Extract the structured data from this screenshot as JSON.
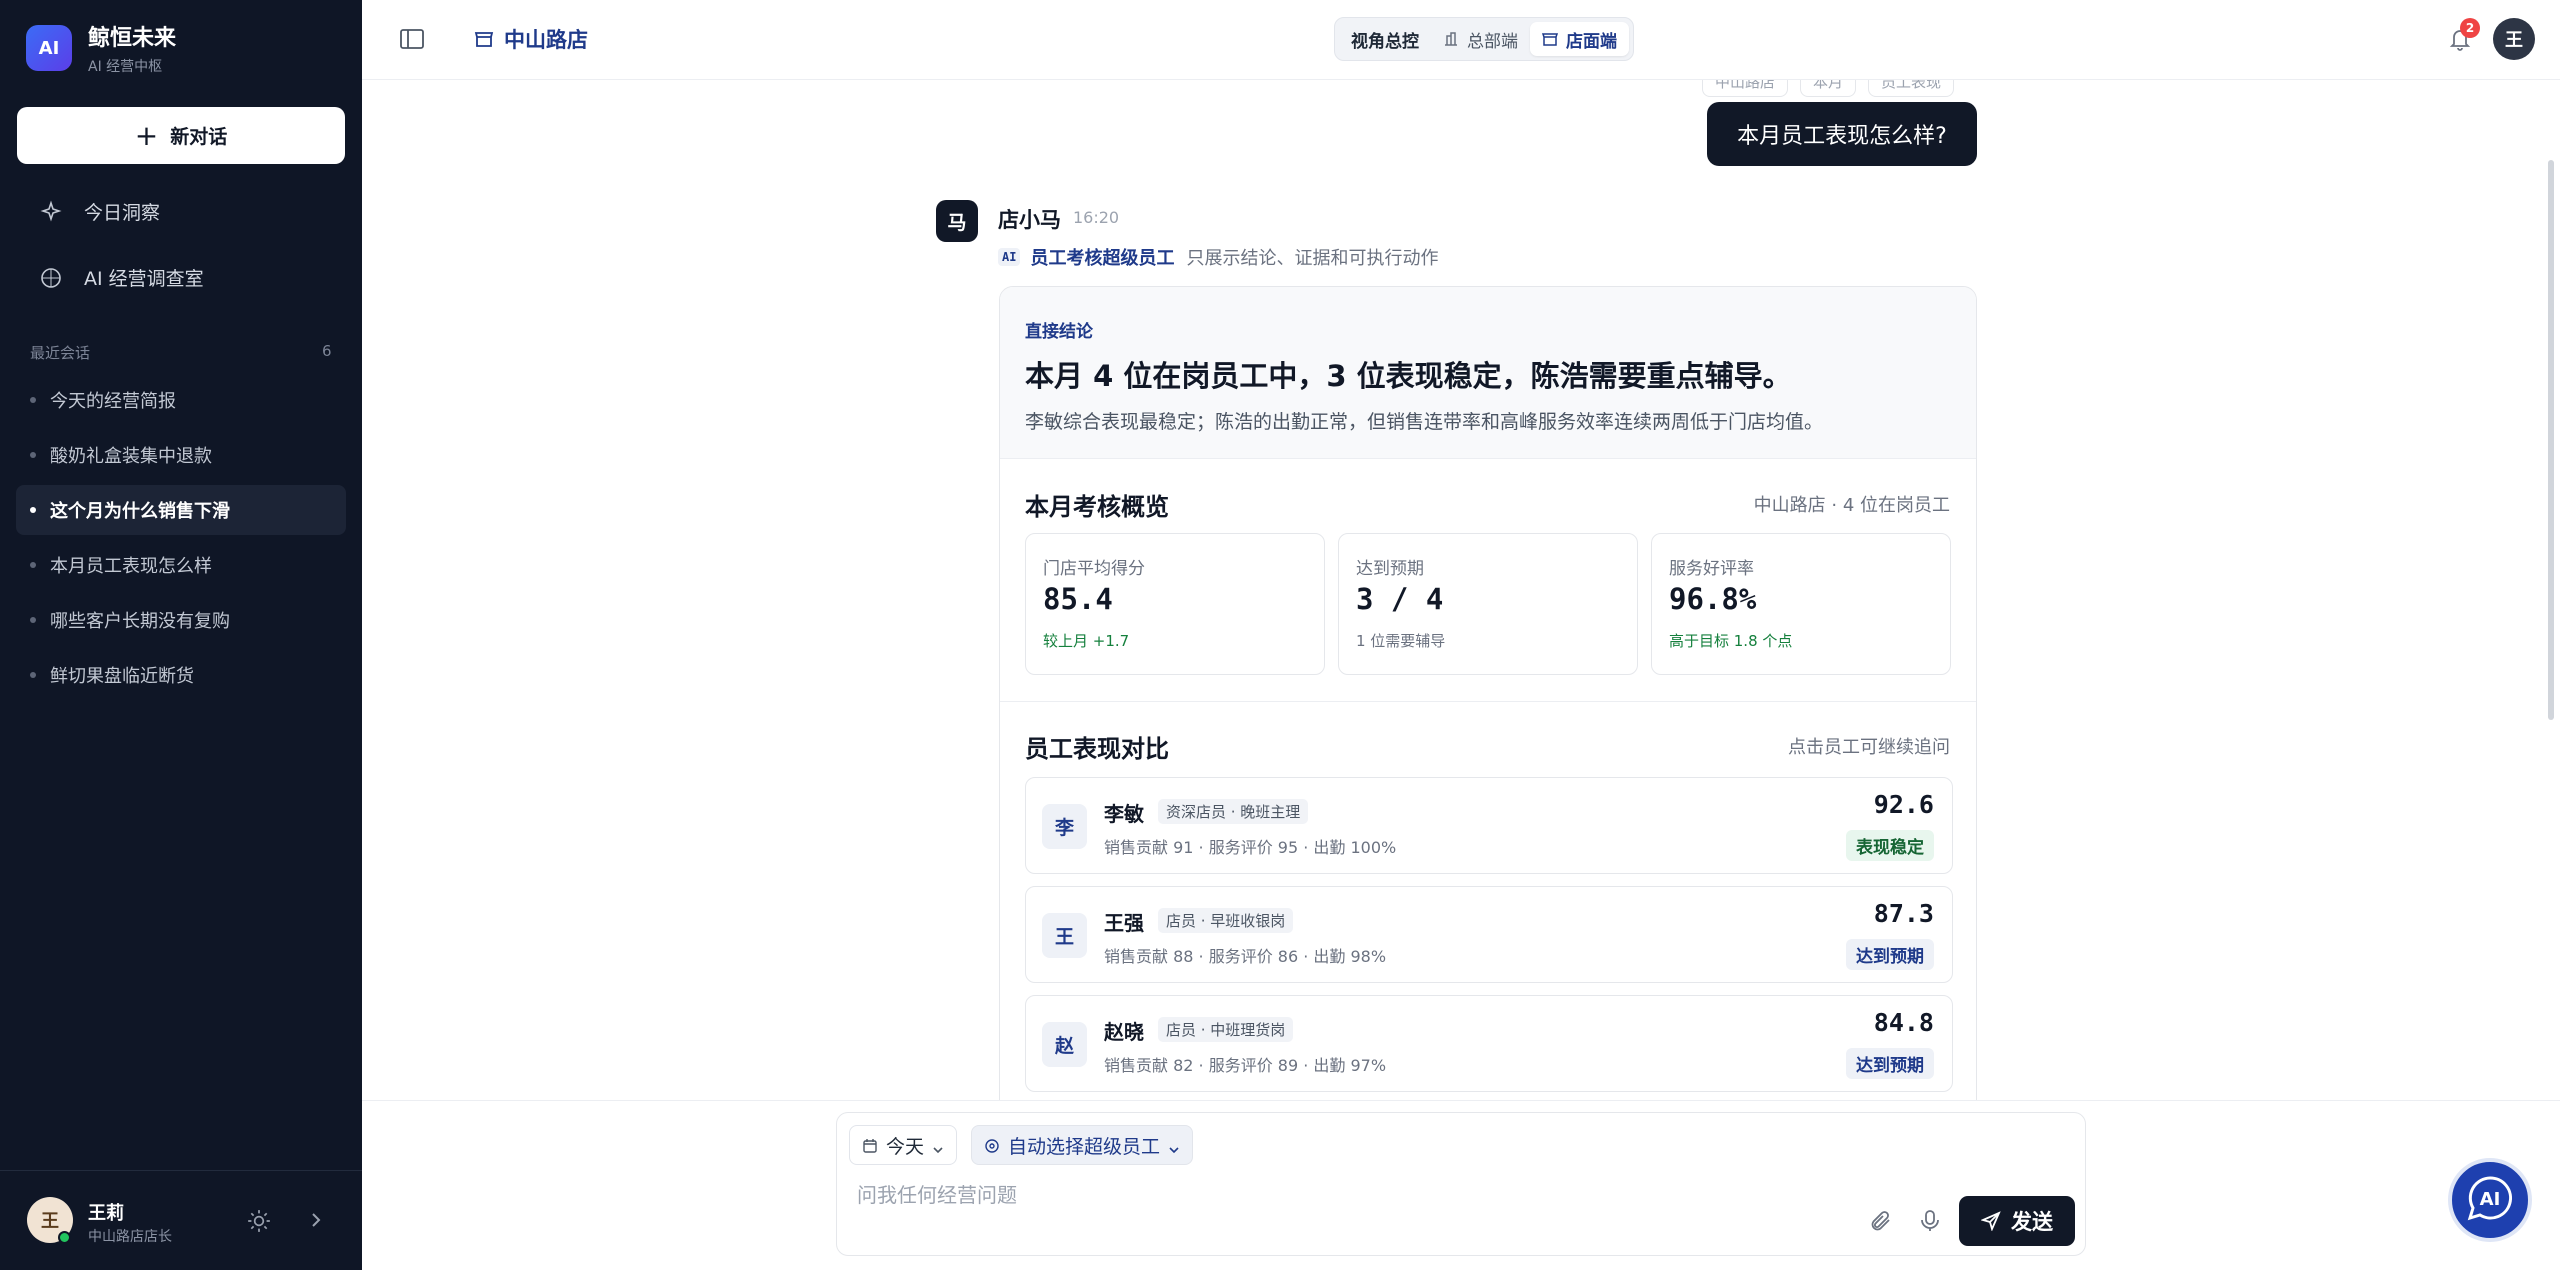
{
  "brand": {
    "logo": "AI",
    "name": "鲸恒未来",
    "subtitle": "AI 经营中枢"
  },
  "sidebar": {
    "new_chat": "新对话",
    "nav": [
      {
        "label": "今日洞察",
        "icon": "sparkle-icon"
      },
      {
        "label": "AI 经营调查室",
        "icon": "compass-icon"
      }
    ],
    "recent_label": "最近会话",
    "recent_count": "6",
    "conversations": [
      {
        "label": "今天的经营简报",
        "active": false
      },
      {
        "label": "酸奶礼盒装集中退款",
        "active": false
      },
      {
        "label": "这个月为什么销售下滑",
        "active": true
      },
      {
        "label": "本月员工表现怎么样",
        "active": false
      },
      {
        "label": "哪些客户长期没有复购",
        "active": false
      },
      {
        "label": "鲜切果盘临近断货",
        "active": false
      }
    ],
    "user": {
      "avatar": "王",
      "name": "王莉",
      "role": "中山路店店长"
    }
  },
  "header": {
    "store": "中山路店",
    "view_label": "视角总控",
    "view_options": [
      {
        "label": "总部端",
        "icon": "building-icon",
        "selected": false
      },
      {
        "label": "店面端",
        "icon": "store-icon",
        "selected": true
      }
    ],
    "notifications": "2",
    "avatar": "王"
  },
  "chat": {
    "prev_chips": [
      "中山路店",
      "本月",
      "员工表现"
    ],
    "user_message": "本月员工表现怎么样?",
    "bot": {
      "avatar": "马",
      "name": "店小马",
      "time": "16:20",
      "agent_tag": "AI",
      "agent_name": "员工考核超级员工",
      "agent_note": "只展示结论、证据和可执行动作"
    },
    "card": {
      "conclusion_label": "直接结论",
      "conclusion_title": "本月 4 位在岗员工中，3 位表现稳定，陈浩需要重点辅导。",
      "conclusion_desc": "李敏综合表现最稳定；陈浩的出勤正常，但销售连带率和高峰服务效率连续两周低于门店均值。",
      "overview_title": "本月考核概览",
      "overview_sub": "中山路店 · 4 位在岗员工",
      "stats": [
        {
          "label": "门店平均得分",
          "value": "85.4",
          "note": "较上月 +1.7",
          "tone": "green"
        },
        {
          "label": "达到预期",
          "value": "3 / 4",
          "note": "1 位需要辅导",
          "tone": "gray"
        },
        {
          "label": "服务好评率",
          "value": "96.8%",
          "note": "高于目标 1.8 个点",
          "tone": "green"
        }
      ],
      "compare_title": "员工表现对比",
      "compare_sub": "点击员工可继续追问",
      "employees": [
        {
          "avatar": "李",
          "name": "李敏",
          "role": "资深店员 · 晚班主理",
          "metrics": "销售贡献 91 · 服务评价 95 · 出勤 100%",
          "score": "92.6",
          "badge": "表现稳定",
          "tone": "green"
        },
        {
          "avatar": "王",
          "name": "王强",
          "role": "店员 · 早班收银岗",
          "metrics": "销售贡献 88 · 服务评价 86 · 出勤 98%",
          "score": "87.3",
          "badge": "达到预期",
          "tone": "blue"
        },
        {
          "avatar": "赵",
          "name": "赵晓",
          "role": "店员 · 中班理货岗",
          "metrics": "销售贡献 82 · 服务评价 89 · 出勤 97%",
          "score": "84.8",
          "badge": "达到预期",
          "tone": "blue"
        }
      ]
    }
  },
  "composer": {
    "date_chip": "今天",
    "agent_chip": "自动选择超级员工",
    "placeholder": "问我任何经营问题",
    "send": "发送"
  },
  "colors": {
    "sidebar_bg": "#0f1626",
    "accent": "#1f3a8a",
    "success": "#15803d",
    "dark_button": "#111827"
  }
}
